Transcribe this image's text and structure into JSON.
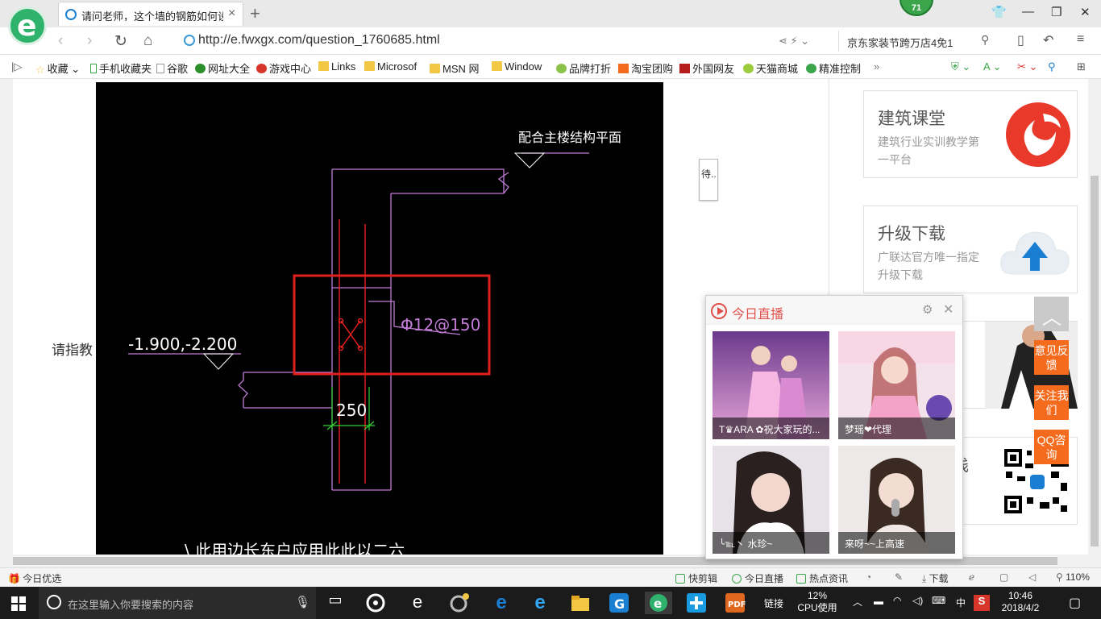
{
  "browser": {
    "tab_title": "请问老师，这个墙的钢筋如何设置",
    "notification_count": "71",
    "url": "http://e.fwxgx.com/question_1760685.html",
    "search_text": "京东家装节跨万店4免1"
  },
  "bookmarks": [
    "收藏",
    "手机收藏夹",
    "谷歌",
    "网址大全",
    "游戏中心",
    "Links",
    "Microsof",
    "MSN 网",
    "Window",
    "品牌打折",
    "淘宝团购",
    "外国网友",
    "天猫商城",
    "精准控制"
  ],
  "page": {
    "question_text": "请指教",
    "pending_label": "待.."
  },
  "cad": {
    "top_label": "配合主楼结构平面",
    "elevation_label": "-1.900,-2.200",
    "rebar_label": "Φ12@150",
    "width_label": "250",
    "bottom_text": "\\ 此用边长东户应用此此以二六"
  },
  "sidebar": {
    "card1": {
      "title": "建筑课堂",
      "subtitle": "建筑行业实训教学第一平台"
    },
    "card2": {
      "title": "升级下载",
      "subtitle": "广联达官方唯一指定升级下载"
    },
    "card4_partial": "栈"
  },
  "float_buttons": {
    "feedback": "意见反馈",
    "follow": "关注我们",
    "qq": "QQ咨询"
  },
  "live": {
    "title": "今日直播",
    "streams": [
      {
        "caption": "T♛ARA ✿祝大家玩的..."
      },
      {
        "caption": "梦瑶❤代理"
      },
      {
        "caption": "╰℡丶 水珍~"
      },
      {
        "caption": "来呀~~上高速"
      }
    ]
  },
  "statusbar": {
    "left": "今日优选",
    "kuaijianji": "快剪辑",
    "live": "今日直播",
    "news": "热点资讯",
    "download": "下载",
    "zoom": "110%"
  },
  "taskbar": {
    "search_placeholder": "在这里输入你要搜索的内容",
    "links": "链接",
    "cpu_percent": "12%",
    "cpu_label": "CPU使用",
    "ime": "中",
    "time": "10:46",
    "date": "2018/4/2"
  },
  "colors": {
    "brand_green": "#2fb36c",
    "accent_orange": "#f46b1e",
    "live_red": "#e0504b",
    "cad_purple": "#c27bd6",
    "cad_red": "#ff2020"
  }
}
